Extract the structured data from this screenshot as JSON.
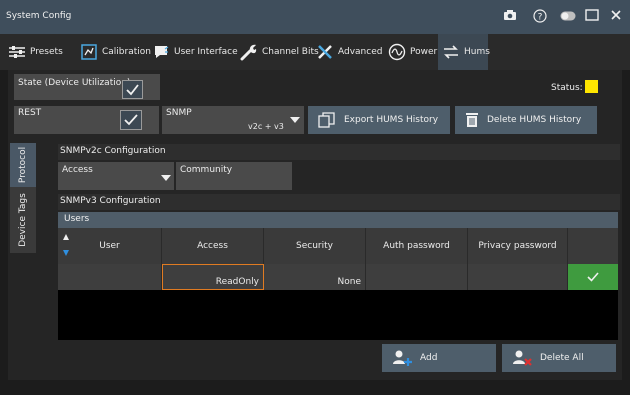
{
  "window": {
    "title": "System Config"
  },
  "tabs": [
    {
      "label": "Presets",
      "icon": "presets-icon"
    },
    {
      "label": "Calibration",
      "icon": "calibration-icon"
    },
    {
      "label": "User Interface",
      "icon": "user-interface-icon"
    },
    {
      "label": "Channel Bits",
      "icon": "wrench-icon"
    },
    {
      "label": "Advanced",
      "icon": "tools-icon"
    },
    {
      "label": "Power",
      "icon": "power-icon"
    },
    {
      "label": "Hums",
      "icon": "hums-icon"
    }
  ],
  "hums": {
    "state_label": "State (Device Utilization)",
    "state_checked": true,
    "status_label": "Status:",
    "status_color": "#ffe600",
    "rest_label": "REST",
    "rest_checked": true,
    "snmp_label": "SNMP",
    "snmp_value": "v2c + v3",
    "export_label": "Export HUMS History",
    "delete_label": "Delete HUMS History"
  },
  "side_tabs": [
    "Protocol",
    "Device Tags"
  ],
  "snmpv2c": {
    "title": "SNMPv2c Configuration",
    "access_label": "Access",
    "community_label": "Community"
  },
  "snmpv3": {
    "title": "SNMPv3 Configuration",
    "users_label": "Users",
    "columns": [
      "User",
      "Access",
      "Security",
      "Auth password",
      "Privacy password"
    ],
    "rows": [
      {
        "user": "",
        "access": "ReadOnly",
        "security": "None",
        "auth": "",
        "privacy": ""
      }
    ],
    "add_label": "Add",
    "delete_all_label": "Delete All"
  },
  "colors": {
    "accent": "#4e5e6b",
    "confirm": "#3f9b3f",
    "highlight": "#e07b22"
  }
}
